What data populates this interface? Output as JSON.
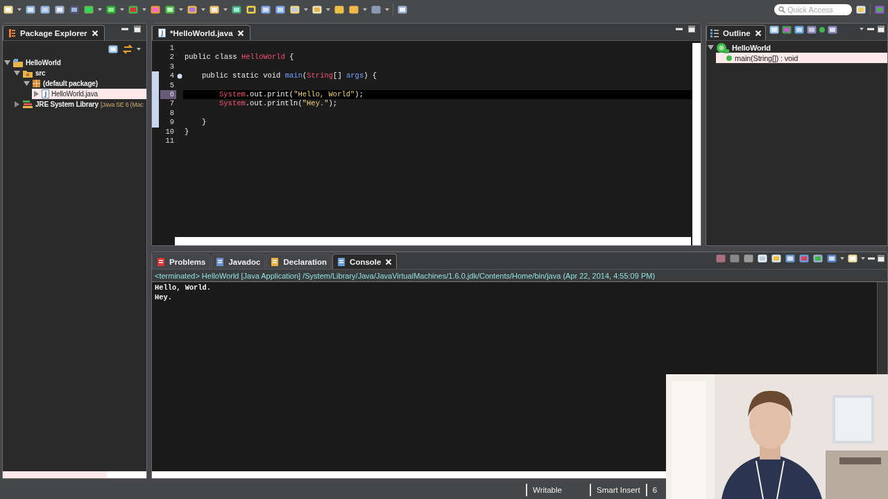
{
  "toolbar": {
    "quick_access": {
      "placeholder": "Quick Access"
    }
  },
  "package_explorer": {
    "tab": {
      "label": "Package Explorer"
    },
    "tree": [
      {
        "label": "HelloWorld",
        "kind": "project",
        "expanded": true,
        "selected": false,
        "children": [
          {
            "label": "src",
            "kind": "folder",
            "expanded": true,
            "selected": false,
            "children": [
              {
                "label": "(default package)",
                "kind": "package",
                "expanded": true,
                "selected": false,
                "children": [
                  {
                    "label": "HelloWorld.java",
                    "kind": "file",
                    "expanded": false,
                    "selected": true
                  }
                ]
              }
            ]
          },
          {
            "label": "JRE System Library",
            "decoration": "[Java SE 6 (Mac",
            "kind": "library",
            "expanded": false,
            "selected": false
          }
        ]
      }
    ]
  },
  "editor": {
    "tab": {
      "label": "*HelloWorld.java"
    },
    "lines": [
      {
        "number": "1",
        "current": false,
        "changed": false
      },
      {
        "number": "2",
        "kind": "top",
        "current": false,
        "changed": false,
        "tokens": [
          {
            "kind": "plain",
            "text": "public class "
          },
          {
            "kind": "type",
            "text": "HelloWorld"
          },
          {
            "kind": "plain",
            "text": " {"
          }
        ]
      },
      {
        "number": "3",
        "current": false,
        "changed": false
      },
      {
        "number": "4",
        "kind": "member",
        "current": false,
        "changed": true,
        "tokens": [
          {
            "kind": "plain",
            "text": "public static void "
          },
          {
            "kind": "method",
            "text": "main"
          },
          {
            "kind": "plain",
            "text": "("
          },
          {
            "kind": "type",
            "text": "String"
          },
          {
            "kind": "plain",
            "text": "[] "
          },
          {
            "kind": "method",
            "text": "args"
          },
          {
            "kind": "plain",
            "text": ") {"
          }
        ]
      },
      {
        "number": "5",
        "current": false,
        "changed": true
      },
      {
        "number": "6",
        "kind": "body",
        "current": true,
        "changed": true,
        "tokens": [
          {
            "kind": "type",
            "text": "System"
          },
          {
            "kind": "plain",
            "text": ".out.print("
          },
          {
            "kind": "string",
            "text": "\"Hello, World\""
          },
          {
            "kind": "plain",
            "text": ");"
          }
        ]
      },
      {
        "number": "7",
        "kind": "body",
        "current": false,
        "changed": true,
        "tokens": [
          {
            "kind": "type",
            "text": "System"
          },
          {
            "kind": "plain",
            "text": ".out.println("
          },
          {
            "kind": "string",
            "text": "\"Hey.\""
          },
          {
            "kind": "plain",
            "text": ");"
          }
        ]
      },
      {
        "number": "8",
        "current": false,
        "changed": true
      },
      {
        "number": "9",
        "kind": "member",
        "current": false,
        "changed": true,
        "tokens": [
          {
            "kind": "plain",
            "text": "}"
          }
        ]
      },
      {
        "number": "10",
        "kind": "top",
        "current": false,
        "changed": false,
        "tokens": [
          {
            "kind": "plain",
            "text": "}"
          }
        ]
      },
      {
        "number": "11",
        "current": false,
        "changed": false
      }
    ]
  },
  "outline": {
    "tab": {
      "label": "Outline"
    },
    "tree": [
      {
        "label": "HelloWorld",
        "kind": "class",
        "expanded": true,
        "selected": false,
        "children": [
          {
            "label": "main(String[]) : void",
            "kind": "method",
            "expanded": false,
            "selected": true
          }
        ]
      }
    ]
  },
  "console_view": {
    "tabs": [
      {
        "label": "Problems",
        "selected": false
      },
      {
        "label": "Javadoc",
        "selected": false
      },
      {
        "label": "Declaration",
        "selected": false
      },
      {
        "label": "Console",
        "selected": true
      }
    ],
    "header": "<terminated> HelloWorld [Java Application] /System/Library/Java/JavaVirtualMachines/1.6.0.jdk/Contents/Home/bin/java (Apr 22, 2014, 4:55:09 PM)",
    "output": [
      "Hello, World.",
      "Hey."
    ]
  },
  "status_bar": [
    "Writable",
    "Smart Insert",
    "6"
  ],
  "webcam": {
    "kind": "picture"
  }
}
